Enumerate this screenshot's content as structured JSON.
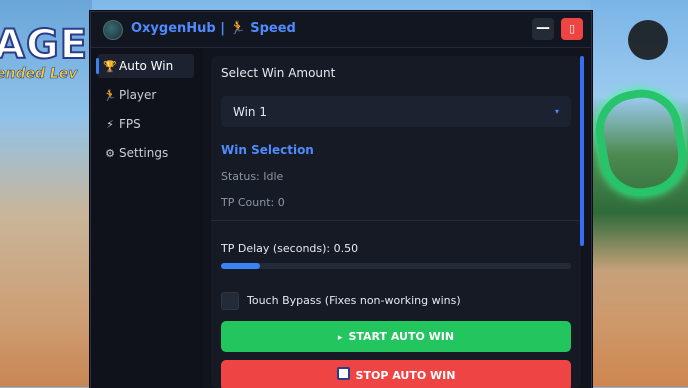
{
  "background": {
    "title_text": "AGE",
    "subtitle_text": "ended Lev"
  },
  "window": {
    "title": "OxygenHub | 🏃 Speed",
    "minimize_label": "—",
    "close_label": "▯"
  },
  "sidebar": {
    "items": [
      {
        "icon": "🏆",
        "label": "Auto Win",
        "icon_name": "trophy-icon",
        "active": true
      },
      {
        "icon": "🏃",
        "label": "Player",
        "icon_name": "runner-icon",
        "active": false
      },
      {
        "icon": "⚡",
        "label": "FPS",
        "icon_name": "lightning-icon",
        "active": false
      },
      {
        "icon": "⚙",
        "label": "Settings",
        "icon_name": "gear-icon",
        "active": false
      }
    ]
  },
  "main": {
    "select_label": "Select Win Amount",
    "select_value": "Win 1",
    "select_caret": "▾",
    "section_title": "Win Selection",
    "status": "Status: Idle",
    "tp_count": "TP Count: 0",
    "delay_label": "TP Delay (seconds): 0.50",
    "delay_fill_fraction": 0.11,
    "bypass_label": "Touch Bypass (Fixes non-working wins)",
    "bypass_checked": false,
    "start_icon": "▸",
    "start_label": "START AUTO WIN",
    "stop_label": "STOP AUTO WIN"
  },
  "colors": {
    "accent": "#4f8bff",
    "start": "#22c55e",
    "stop": "#ef4444",
    "panel": "#11141c"
  }
}
